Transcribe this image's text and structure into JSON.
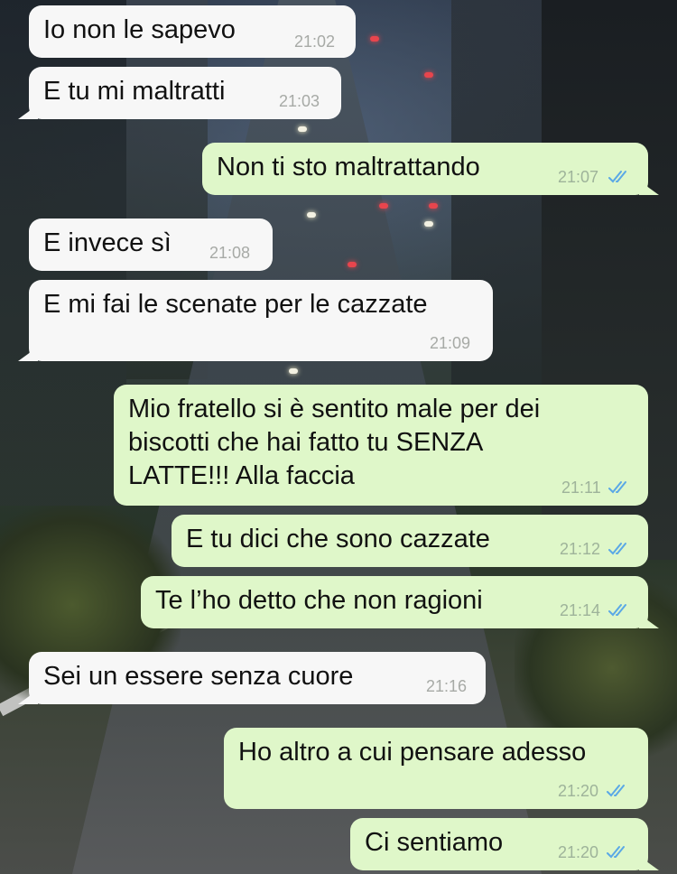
{
  "messages": [
    {
      "dir": "in",
      "text": "Io non le sapevo",
      "time": "21:02"
    },
    {
      "dir": "in",
      "text": "E tu mi maltratti",
      "time": "21:03"
    },
    {
      "dir": "out",
      "text": "Non ti sto maltrattando",
      "time": "21:07"
    },
    {
      "dir": "in",
      "text": "E invece sì",
      "time": "21:08"
    },
    {
      "dir": "in",
      "text": "E mi fai le scenate per le cazzate",
      "time": "21:09"
    },
    {
      "dir": "out",
      "text": "Mio fratello si è sentito male per dei\nbiscotti che hai fatto tu SENZA\nLATTE!!! Alla faccia",
      "time": "21:11"
    },
    {
      "dir": "out",
      "text": "E tu dici che sono cazzate",
      "time": "21:12"
    },
    {
      "dir": "out",
      "text": "Te l’ho detto che non ragioni",
      "time": "21:14"
    },
    {
      "dir": "in",
      "text": "Sei un essere senza cuore",
      "time": "21:16"
    },
    {
      "dir": "out",
      "text": "Ho altro a cui pensare adesso",
      "time": "21:20"
    },
    {
      "dir": "out",
      "text": "Ci sentiamo",
      "time": "21:20"
    }
  ],
  "colors": {
    "incoming_bubble": "#f7f7f7",
    "outgoing_bubble": "#dff7c9",
    "read_ticks": "#5aa8e6",
    "timestamp": "#a7aaa6"
  },
  "icons": {
    "read_receipt": "double-check-icon"
  }
}
